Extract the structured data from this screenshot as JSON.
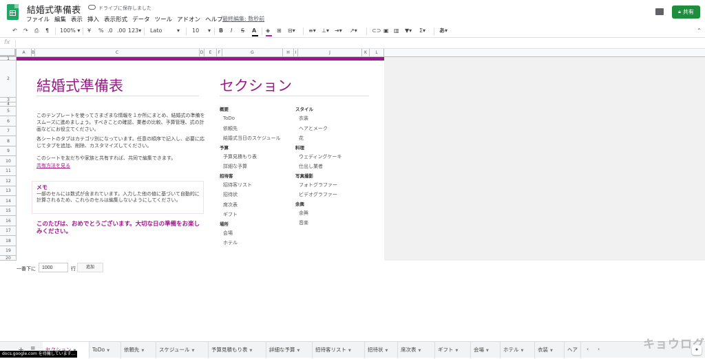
{
  "app": {
    "title": "結婚式準備表",
    "save_status": "ドライブに保存しました",
    "last_edit": "最終編集: 数秒前",
    "share_label": "共有"
  },
  "menu": [
    "ファイル",
    "編集",
    "表示",
    "挿入",
    "表示形式",
    "データ",
    "ツール",
    "アドオン",
    "ヘルプ"
  ],
  "toolbar": {
    "zoom": "100%",
    "currency": "¥",
    "percent": "%",
    "decimal_less": ".0",
    "decimal_more": ".00",
    "number_format": "123",
    "font": "Lato",
    "font_size": "10",
    "bold": "B",
    "italic": "I",
    "strike": "S",
    "text_color": "A",
    "input_tools": "あ"
  },
  "formula_bar": {
    "fx": "fx"
  },
  "columns": [
    "A",
    "B",
    "C",
    "D",
    "E",
    "F",
    "G",
    "H",
    "I",
    "J",
    "K",
    "L"
  ],
  "rows": [
    "1",
    "2",
    "3",
    "4",
    "5",
    "6",
    "7",
    "8",
    "9",
    "10",
    "11",
    "12",
    "13",
    "14",
    "15",
    "16",
    "17",
    "18",
    "19",
    "20"
  ],
  "sheet": {
    "title": "結婚式準備表",
    "section_title": "セクション",
    "intro": [
      "このテンプレートを使ってさまざまな情報を１か所にまとめ、結婚式の準備をスムーズに進めましょう。すべきことの確認、業者の比較、予算管理、式の計画などにお役立てください。",
      "各シートのタブはカテゴリ別になっています。任意の順序で記入し、必要に応じてタブを追加、削除、カスタマイズしてください。",
      "このシートを友だちや家族と共有すれば、共同で編集できます。"
    ],
    "share_link": "共有方法を見る",
    "memo_title": "メモ",
    "memo_text": "一部のセルには数式が含まれています。入力した他の値に基づいて自動的に計算されるため、これらのセルは編集しないようにしてください。",
    "congrats": "このたびは、おめでとうございます。大切な日の準備をお楽しみください。",
    "sections_left": [
      {
        "group": "概要",
        "items": [
          "ToDo",
          "依頼先",
          "結婚式当日のスケジュール"
        ]
      },
      {
        "group": "予算",
        "items": [
          "予算見積もり表",
          "詳細な予算"
        ]
      },
      {
        "group": "招待客",
        "items": [
          "招待客リスト",
          "招待状",
          "席次表",
          "ギフト"
        ]
      },
      {
        "group": "場所",
        "items": [
          "会場",
          "ホテル"
        ]
      }
    ],
    "sections_right": [
      {
        "group": "スタイル",
        "items": [
          "衣装",
          "ヘアとメーク",
          "花"
        ]
      },
      {
        "group": "料理",
        "items": [
          "ウェディングケーキ",
          "仕出し業者"
        ]
      },
      {
        "group": "写真撮影",
        "items": [
          "フォトグラファー",
          "ビデオグラファー"
        ]
      },
      {
        "group": "余興",
        "items": [
          "余興",
          "音楽"
        ]
      }
    ]
  },
  "add_rows": {
    "label": "一番下に",
    "value": "1000",
    "unit": "行",
    "button": "追加"
  },
  "tabs": [
    "セクション",
    "ToDo",
    "依頼先",
    "スケジュール",
    "予算見積もり表",
    "詳細な予算",
    "招待客リスト",
    "招待状",
    "席次表",
    "ギフト",
    "会場",
    "ホテル",
    "衣装",
    "ヘア"
  ],
  "status_url": "docs.google.com を待機しています...",
  "watermark": "キョウログ",
  "colors": {
    "accent": "#9c1789",
    "brand": "#1e8e3e"
  }
}
